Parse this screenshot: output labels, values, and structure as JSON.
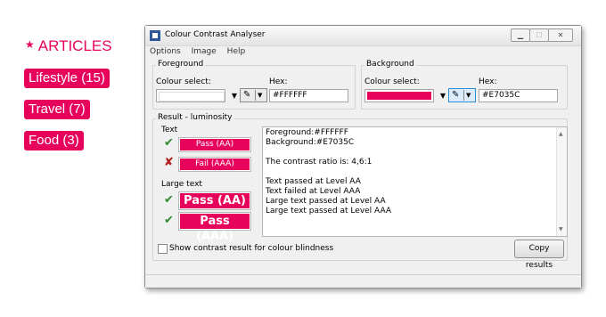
{
  "articles": {
    "heading": "ARTICLES",
    "tags": [
      {
        "label": "Lifestyle (15)"
      },
      {
        "label": "Travel (7)"
      },
      {
        "label": "Food (3)"
      }
    ]
  },
  "window": {
    "title": "Colour Contrast Analyser",
    "menu": [
      "Options",
      "Image",
      "Help"
    ],
    "foreground": {
      "group_label": "Foreground",
      "colour_select_label": "Colour select:",
      "hex_label": "Hex:",
      "hex_value": "#FFFFFF",
      "swatch_color": "#FFFFFF"
    },
    "background": {
      "group_label": "Background",
      "colour_select_label": "Colour select:",
      "hex_label": "Hex:",
      "hex_value": "#E7035C",
      "swatch_color": "#E7035C"
    },
    "result": {
      "group_label": "Result - luminosity",
      "text_label": "Text",
      "large_text_label": "Large text",
      "text_results": [
        {
          "label": "Pass (AA)",
          "status": "pass"
        },
        {
          "label": "Fail (AAA)",
          "status": "fail"
        }
      ],
      "large_results": [
        {
          "label": "Pass (AA)",
          "status": "pass"
        },
        {
          "label": "Pass (AAA)",
          "status": "pass"
        }
      ],
      "report_lines": [
        "Foreground:#FFFFFF",
        "Background:#E7035C",
        "",
        "The contrast ratio is: 4,6:1",
        "",
        "Text passed at Level AA",
        "Text failed at Level AAA",
        "Large text passed at Level AA",
        "Large text passed at Level AAA"
      ]
    },
    "colour_blindness_label": "Show contrast result for colour blindness",
    "copy_button_label": "Copy results"
  }
}
